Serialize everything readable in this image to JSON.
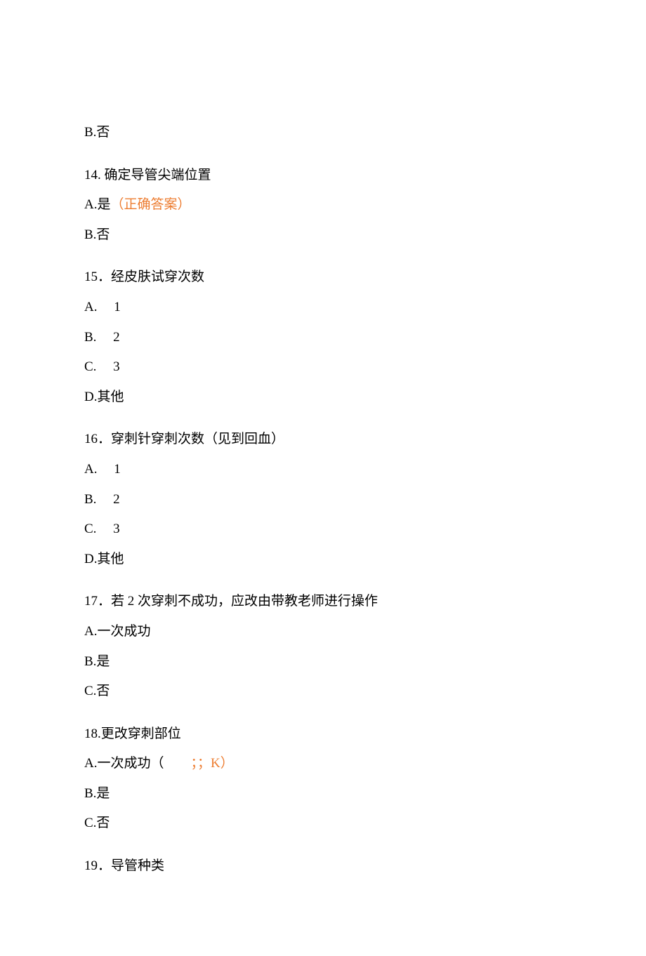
{
  "colors": {
    "accent": "#ED7D31"
  },
  "top": {
    "b_no": "B.否"
  },
  "q14": {
    "question": "14. 确定导管尖端位置",
    "a_prefix": "A.是",
    "a_note": "（正确答案）",
    "b": "B.否"
  },
  "q15": {
    "question": "15．经皮肤试穿次数",
    "a": "A.  1",
    "b": "B.  2",
    "c": "C.  3",
    "d": "D.其他"
  },
  "q16": {
    "question": "16．穿刺针穿刺次数（见到回血）",
    "a": "A.  1",
    "b": "B.  2",
    "c": "C.  3",
    "d": "D.其他"
  },
  "q17": {
    "question": "17．若 2 次穿刺不成功，应改由带教老师进行操作",
    "a": "A.一次成功",
    "b": "B.是",
    "c": "C.否"
  },
  "q18": {
    "question": "18.更改穿刺部位",
    "a_prefix": "A.一次成功（  ",
    "a_note": "；；K）",
    "b": "B.是",
    "c": "C.否"
  },
  "q19": {
    "question": "19．导管种类"
  }
}
